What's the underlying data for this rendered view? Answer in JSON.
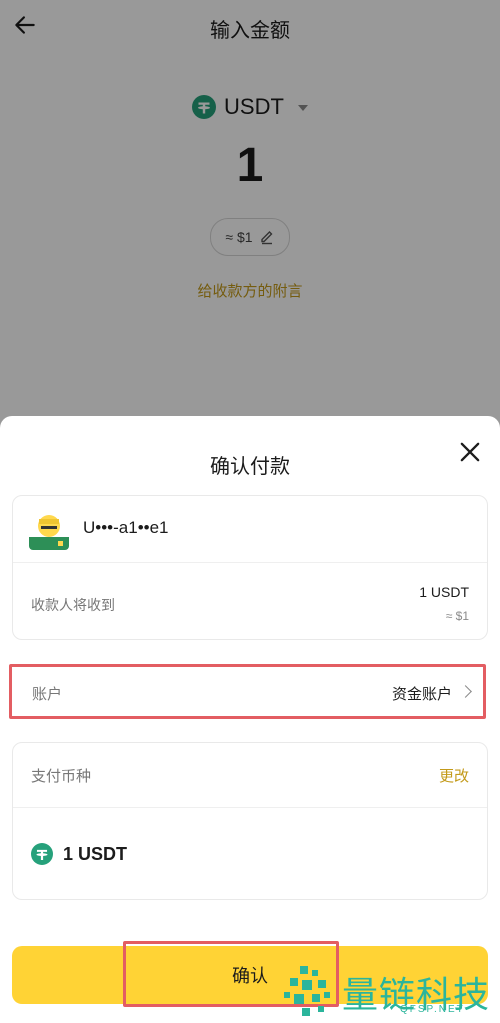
{
  "header": {
    "title": "输入金额"
  },
  "asset": {
    "name": "USDT",
    "amount": "1",
    "approx": "≈ $1"
  },
  "memo_link": "给收款方的附言",
  "sheet": {
    "title": "确认付款",
    "payee": {
      "name": "U•••-a1••e1"
    },
    "receive": {
      "label": "收款人将收到",
      "amount": "1 USDT",
      "usd": "≈ $1"
    },
    "account": {
      "label": "账户",
      "value": "资金账户"
    },
    "currency": {
      "label": "支付币种",
      "change": "更改",
      "amount": "1 USDT"
    },
    "confirm_label": "确认"
  },
  "watermark": {
    "text": "量链科技",
    "sub": "QFSP.NET"
  },
  "colors": {
    "accent": "#ffd335",
    "link": "#c39a1a",
    "usdt": "#26a17b",
    "highlight": "#e35d62"
  }
}
